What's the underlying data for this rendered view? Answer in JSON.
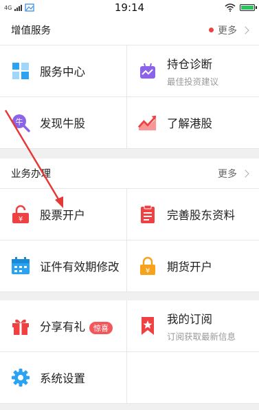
{
  "status_bar": {
    "network": "4G",
    "time": "19:14"
  },
  "value_added": {
    "title": "增值服务",
    "more": "更多",
    "items": [
      {
        "label": "服务中心",
        "sub": ""
      },
      {
        "label": "持仓诊断",
        "sub": "最佳投资建议"
      },
      {
        "label": "发现牛股",
        "sub": ""
      },
      {
        "label": "了解港股",
        "sub": ""
      }
    ]
  },
  "business": {
    "title": "业务办理",
    "more": "更多",
    "items": [
      {
        "label": "股票开户",
        "sub": ""
      },
      {
        "label": "完善股东资料",
        "sub": ""
      },
      {
        "label": "证件有效期修改",
        "sub": ""
      },
      {
        "label": "期货开户",
        "sub": ""
      }
    ]
  },
  "others": {
    "items": [
      {
        "label": "分享有礼",
        "badge": "惊喜",
        "sub": ""
      },
      {
        "label": "我的订阅",
        "sub": "订阅获取最新信息"
      },
      {
        "label": "系统设置",
        "sub": ""
      }
    ]
  },
  "colors": {
    "accent_red": "#f04142",
    "blue_icon": "#2aa3f2",
    "purple_icon": "#8b63e8",
    "orange_icon": "#f7a21b"
  }
}
